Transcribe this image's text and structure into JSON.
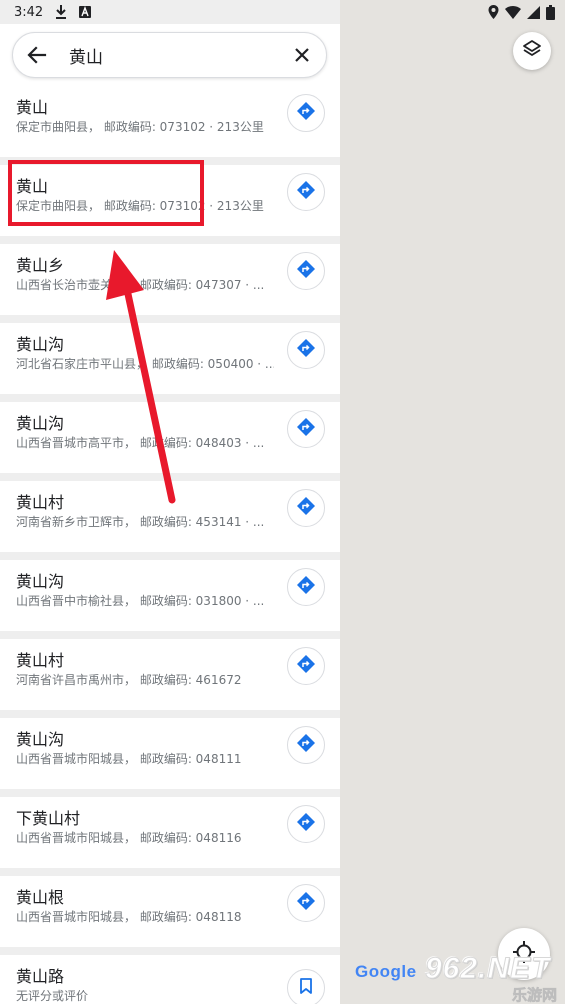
{
  "status_bar": {
    "time": "3:42",
    "icons": [
      "download-icon",
      "a-notification-icon",
      "location-icon",
      "wifi-icon",
      "signal-icon",
      "battery-icon"
    ]
  },
  "search": {
    "value": "黄山",
    "placeholder": "",
    "back_icon": "arrow-left-icon",
    "clear_icon": "close-icon"
  },
  "results": [
    {
      "name": "黄山",
      "address": "保定市曲阳县， 邮政编码: 073102 · 213公里",
      "action_icon": "directions-icon"
    },
    {
      "name": "黄山",
      "address": "保定市曲阳县， 邮政编码: 073102 · 213公里",
      "action_icon": "directions-icon"
    },
    {
      "name": "黄山乡",
      "address": "山西省长治市壶关县， 邮政编码: 047307 · ...",
      "action_icon": "directions-icon"
    },
    {
      "name": "黄山沟",
      "address": "河北省石家庄市平山县， 邮政编码: 050400 · ...",
      "action_icon": "directions-icon"
    },
    {
      "name": "黄山沟",
      "address": "山西省晋城市高平市， 邮政编码: 048403 · ...",
      "action_icon": "directions-icon"
    },
    {
      "name": "黄山村",
      "address": "河南省新乡市卫辉市， 邮政编码: 453141 · ...",
      "action_icon": "directions-icon"
    },
    {
      "name": "黄山沟",
      "address": "山西省晋中市榆社县， 邮政编码: 031800 · ...",
      "action_icon": "directions-icon"
    },
    {
      "name": "黄山村",
      "address": "河南省许昌市禹州市， 邮政编码: 461672",
      "action_icon": "directions-icon"
    },
    {
      "name": "黄山沟",
      "address": "山西省晋城市阳城县， 邮政编码: 048111",
      "action_icon": "directions-icon"
    },
    {
      "name": "下黄山村",
      "address": "山西省晋城市阳城县， 邮政编码: 048116",
      "action_icon": "directions-icon"
    },
    {
      "name": "黄山根",
      "address": "山西省晋城市阳城县， 邮政编码: 048118",
      "action_icon": "directions-icon"
    },
    {
      "name": "黄山路",
      "address": "无评分或评价",
      "action_icon": "bookmark-icon"
    }
  ],
  "map": {
    "layers_icon": "layers-icon",
    "locate_icon": "my-location-icon",
    "logo": "Google"
  },
  "watermark": {
    "top": "962.NET",
    "bottom": "乐游网"
  },
  "colors": {
    "accent": "#1a73e8",
    "highlight": "#e8192c",
    "text_primary": "#202124",
    "text_secondary": "#70757a"
  }
}
